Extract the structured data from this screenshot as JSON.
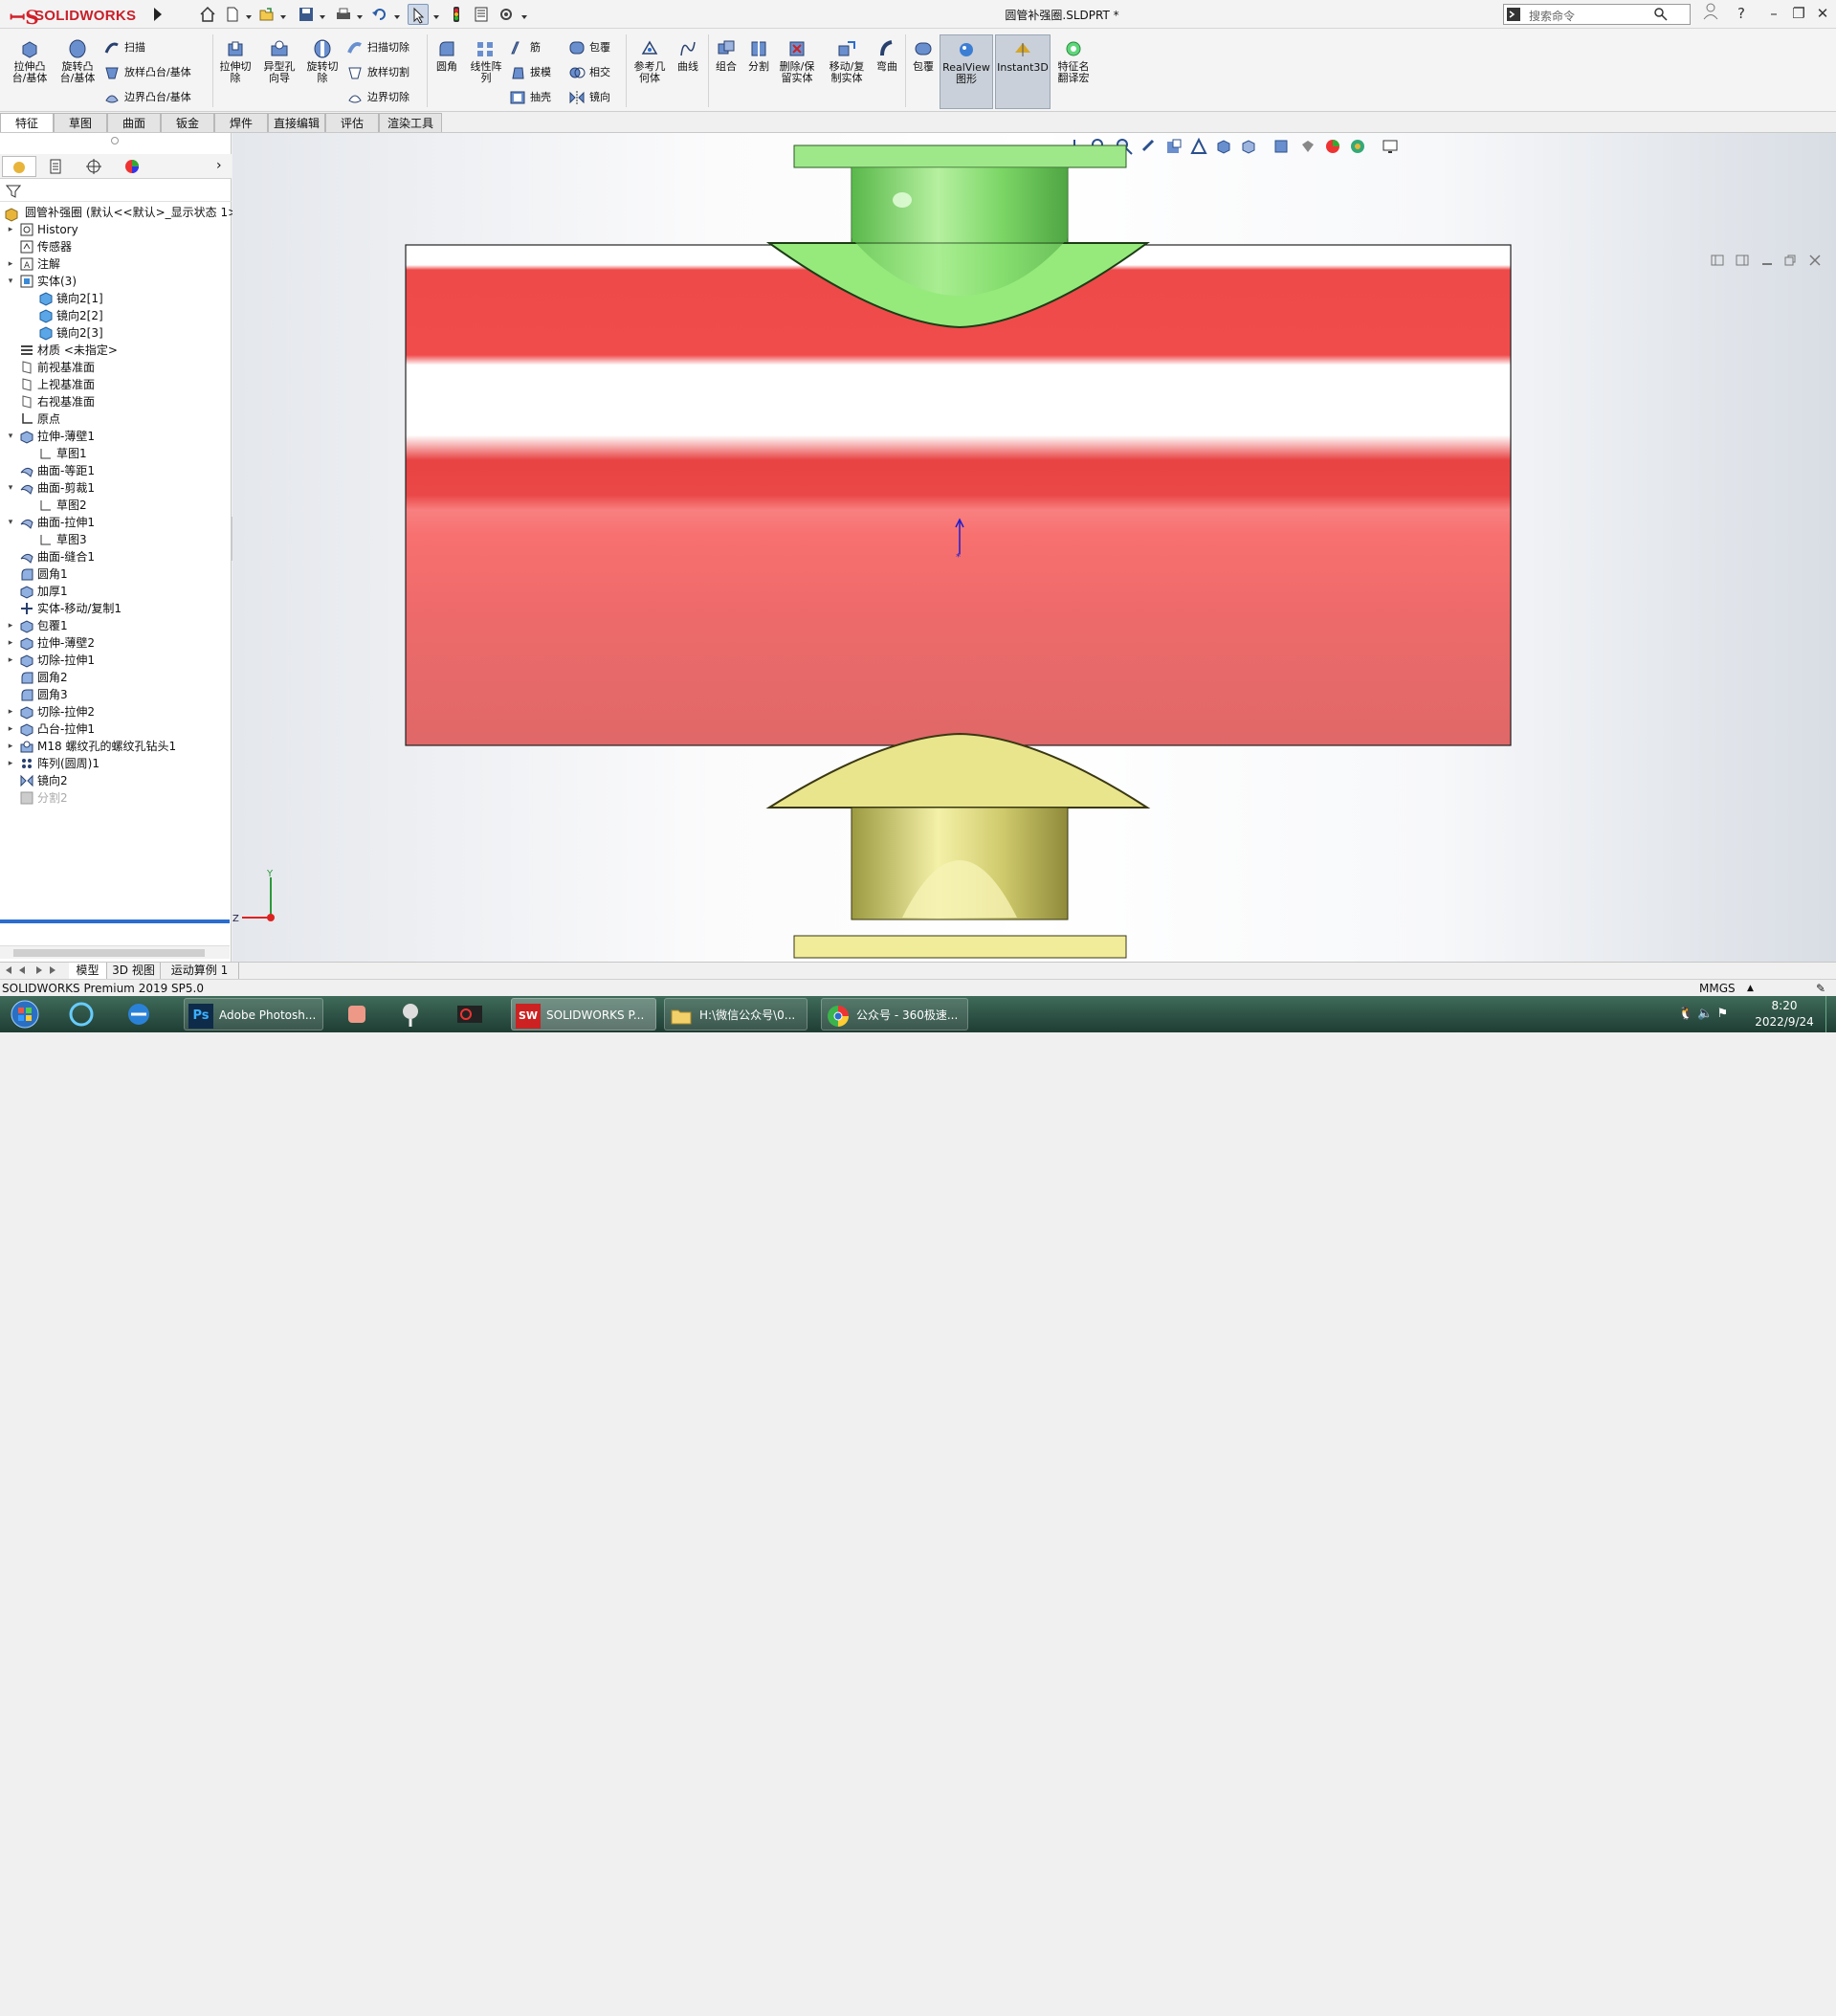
{
  "app": {
    "logo_text": "SOLIDWORKS",
    "doc_title": "圆管补强圈.SLDPRT *",
    "search_placeholder": "搜索命令",
    "window_controls": [
      "?",
      "–",
      "❐",
      "✕"
    ]
  },
  "ribbon": {
    "big_buttons": [
      {
        "id": "extrude-boss",
        "label": "拉伸凸\n台/基体"
      },
      {
        "id": "revolve-boss",
        "label": "旋转凸\n台/基体"
      },
      {
        "id": "extrude-cut",
        "label": "拉伸切\n除"
      },
      {
        "id": "hole-wizard",
        "label": "异型孔\n向导"
      },
      {
        "id": "revolve-cut",
        "label": "旋转切\n除"
      },
      {
        "id": "fillet",
        "label": "圆角"
      },
      {
        "id": "linear-pattern",
        "label": "线性阵\n列"
      },
      {
        "id": "ref-geometry",
        "label": "参考几\n何体"
      },
      {
        "id": "curves",
        "label": "曲线"
      },
      {
        "id": "combine",
        "label": "组合"
      },
      {
        "id": "split",
        "label": "分割"
      },
      {
        "id": "delete-keep-body",
        "label": "删除/保\n留实体"
      },
      {
        "id": "move-copy-body",
        "label": "移动/复\n制实体"
      },
      {
        "id": "flex",
        "label": "弯曲"
      },
      {
        "id": "wrap2",
        "label": "包覆"
      },
      {
        "id": "realview",
        "label": "RealView\n图形"
      },
      {
        "id": "instant3d",
        "label": "Instant3D"
      },
      {
        "id": "feature-translate",
        "label": "特征名\n翻译宏"
      }
    ],
    "small_buttons": [
      {
        "id": "sweep",
        "label": "扫描"
      },
      {
        "id": "loft",
        "label": "放样凸台/基体"
      },
      {
        "id": "boundary",
        "label": "边界凸台/基体"
      },
      {
        "id": "swept-cut",
        "label": "扫描切除"
      },
      {
        "id": "lofted-cut",
        "label": "放样切割"
      },
      {
        "id": "boundary-cut",
        "label": "边界切除"
      },
      {
        "id": "rib",
        "label": "筋"
      },
      {
        "id": "draft",
        "label": "拔模"
      },
      {
        "id": "shell",
        "label": "抽壳"
      },
      {
        "id": "wrap",
        "label": "包覆"
      },
      {
        "id": "intersect",
        "label": "相交"
      },
      {
        "id": "mirror",
        "label": "镜向"
      }
    ]
  },
  "tabs": [
    "特征",
    "草图",
    "曲面",
    "钣金",
    "焊件",
    "直接编辑",
    "评估",
    "渲染工具"
  ],
  "tree": {
    "root": "圆管补强圈 (默认<<默认>_显示状态 1>)",
    "items": [
      {
        "label": "History",
        "lvl": 1,
        "exp": "▸",
        "icon": "history-icon"
      },
      {
        "label": "传感器",
        "lvl": 1,
        "exp": "",
        "icon": "sensor-icon"
      },
      {
        "label": "注解",
        "lvl": 1,
        "exp": "▸",
        "icon": "annotation-icon"
      },
      {
        "label": "实体(3)",
        "lvl": 1,
        "exp": "▾",
        "icon": "solid-bodies-icon"
      },
      {
        "label": "镜向2[1]",
        "lvl": 2,
        "exp": "",
        "icon": "body-icon"
      },
      {
        "label": "镜向2[2]",
        "lvl": 2,
        "exp": "",
        "icon": "body-icon"
      },
      {
        "label": "镜向2[3]",
        "lvl": 2,
        "exp": "",
        "icon": "body-icon"
      },
      {
        "label": "材质 <未指定>",
        "lvl": 1,
        "exp": "",
        "icon": "material-icon"
      },
      {
        "label": "前视基准面",
        "lvl": 1,
        "exp": "",
        "icon": "plane-icon"
      },
      {
        "label": "上视基准面",
        "lvl": 1,
        "exp": "",
        "icon": "plane-icon"
      },
      {
        "label": "右视基准面",
        "lvl": 1,
        "exp": "",
        "icon": "plane-icon"
      },
      {
        "label": "原点",
        "lvl": 1,
        "exp": "",
        "icon": "origin-icon"
      },
      {
        "label": "拉伸-薄壁1",
        "lvl": 1,
        "exp": "▾",
        "icon": "feature-icon"
      },
      {
        "label": "草图1",
        "lvl": 2,
        "exp": "",
        "icon": "sketch-icon"
      },
      {
        "label": "曲面-等距1",
        "lvl": 1,
        "exp": "",
        "icon": "surface-icon"
      },
      {
        "label": "曲面-剪裁1",
        "lvl": 1,
        "exp": "▾",
        "icon": "surface-icon"
      },
      {
        "label": "草图2",
        "lvl": 2,
        "exp": "",
        "icon": "sketch-icon"
      },
      {
        "label": "曲面-拉伸1",
        "lvl": 1,
        "exp": "▾",
        "icon": "surface-icon"
      },
      {
        "label": "草图3",
        "lvl": 2,
        "exp": "",
        "icon": "sketch-icon"
      },
      {
        "label": "曲面-缝合1",
        "lvl": 1,
        "exp": "",
        "icon": "surface-icon"
      },
      {
        "label": "圆角1",
        "lvl": 1,
        "exp": "",
        "icon": "fillet-icon"
      },
      {
        "label": "加厚1",
        "lvl": 1,
        "exp": "",
        "icon": "feature-icon"
      },
      {
        "label": "实体-移动/复制1",
        "lvl": 1,
        "exp": "",
        "icon": "move-icon"
      },
      {
        "label": "包覆1",
        "lvl": 1,
        "exp": "▸",
        "icon": "feature-icon"
      },
      {
        "label": "拉伸-薄壁2",
        "lvl": 1,
        "exp": "▸",
        "icon": "feature-icon"
      },
      {
        "label": "切除-拉伸1",
        "lvl": 1,
        "exp": "▸",
        "icon": "feature-icon"
      },
      {
        "label": "圆角2",
        "lvl": 1,
        "exp": "",
        "icon": "fillet-icon"
      },
      {
        "label": "圆角3",
        "lvl": 1,
        "exp": "",
        "icon": "fillet-icon"
      },
      {
        "label": "切除-拉伸2",
        "lvl": 1,
        "exp": "▸",
        "icon": "feature-icon"
      },
      {
        "label": "凸台-拉伸1",
        "lvl": 1,
        "exp": "▸",
        "icon": "feature-icon"
      },
      {
        "label": "M18 螺纹孔的螺纹孔钻头1",
        "lvl": 1,
        "exp": "▸",
        "icon": "hole-icon"
      },
      {
        "label": "阵列(圆周)1",
        "lvl": 1,
        "exp": "▸",
        "icon": "pattern-icon"
      },
      {
        "label": "镜向2",
        "lvl": 1,
        "exp": "",
        "icon": "mirror-icon"
      },
      {
        "label": "分割2",
        "lvl": 1,
        "exp": "",
        "icon": "split-icon",
        "faded": true
      }
    ]
  },
  "bottom_tabs": [
    "模型",
    "3D 视图",
    "运动算例 1"
  ],
  "status": {
    "version": "SOLIDWORKS Premium 2019 SP5.0",
    "units": "MMGS"
  },
  "taskbar": {
    "apps": [
      {
        "label": "Adobe Photosh...",
        "icon": "photoshop-icon",
        "badge": "Ps"
      },
      {
        "label": "SOLIDWORKS P...",
        "icon": "solidworks-icon",
        "badge": "SW"
      },
      {
        "label": "H:\\微信公众号\\0...",
        "icon": "folder-icon",
        "badge": ""
      },
      {
        "label": "公众号 - 360极速...",
        "icon": "browser-icon",
        "badge": ""
      }
    ],
    "time": "8:20",
    "date": "2022/9/24"
  },
  "colors": {
    "pipe_red": "#ee4a4a",
    "nozzle_green": "#8ae06a",
    "nozzle_yellow": "#e7e08a",
    "accent_blue": "#2a6dcf"
  }
}
